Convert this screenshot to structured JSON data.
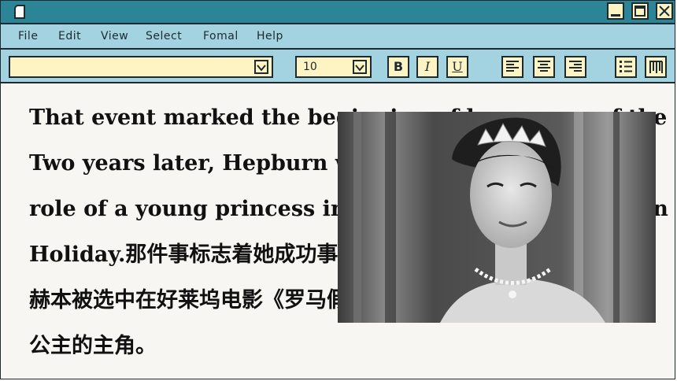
{
  "window": {
    "icons": [
      "document-icon",
      "minimize-icon",
      "maximize-icon",
      "close-icon"
    ]
  },
  "menu": {
    "items": [
      "File",
      "Edit",
      "View",
      "Select",
      "Fomal",
      "Help"
    ]
  },
  "toolbar": {
    "font_select_value": "",
    "size_select_value": "10",
    "bold_label": "B",
    "italic_label": "I",
    "underline_label": "U",
    "icons": [
      "align-left-icon",
      "align-center-icon",
      "align-right-icon",
      "bulleted-list-icon",
      "column-icon"
    ]
  },
  "document": {
    "lines": [
      "That event marked the beginning of her career of the",
      "Two years later, Hepburn was chosen for the",
      "role of a young princess in the Hollywood film Roman",
      "Holiday.那件事标志着她成功事业的开端。两年后，",
      "赫本被选中在好莱坞电影《罗马假日》中扮演一位年轻",
      "公主的主角。"
    ]
  },
  "colors": {
    "titlebar": "#2b8597",
    "menubar": "#a3d2e0",
    "button_fill": "#fdf3c3",
    "outline": "#1f2a30",
    "page": "#f7f6f2"
  }
}
